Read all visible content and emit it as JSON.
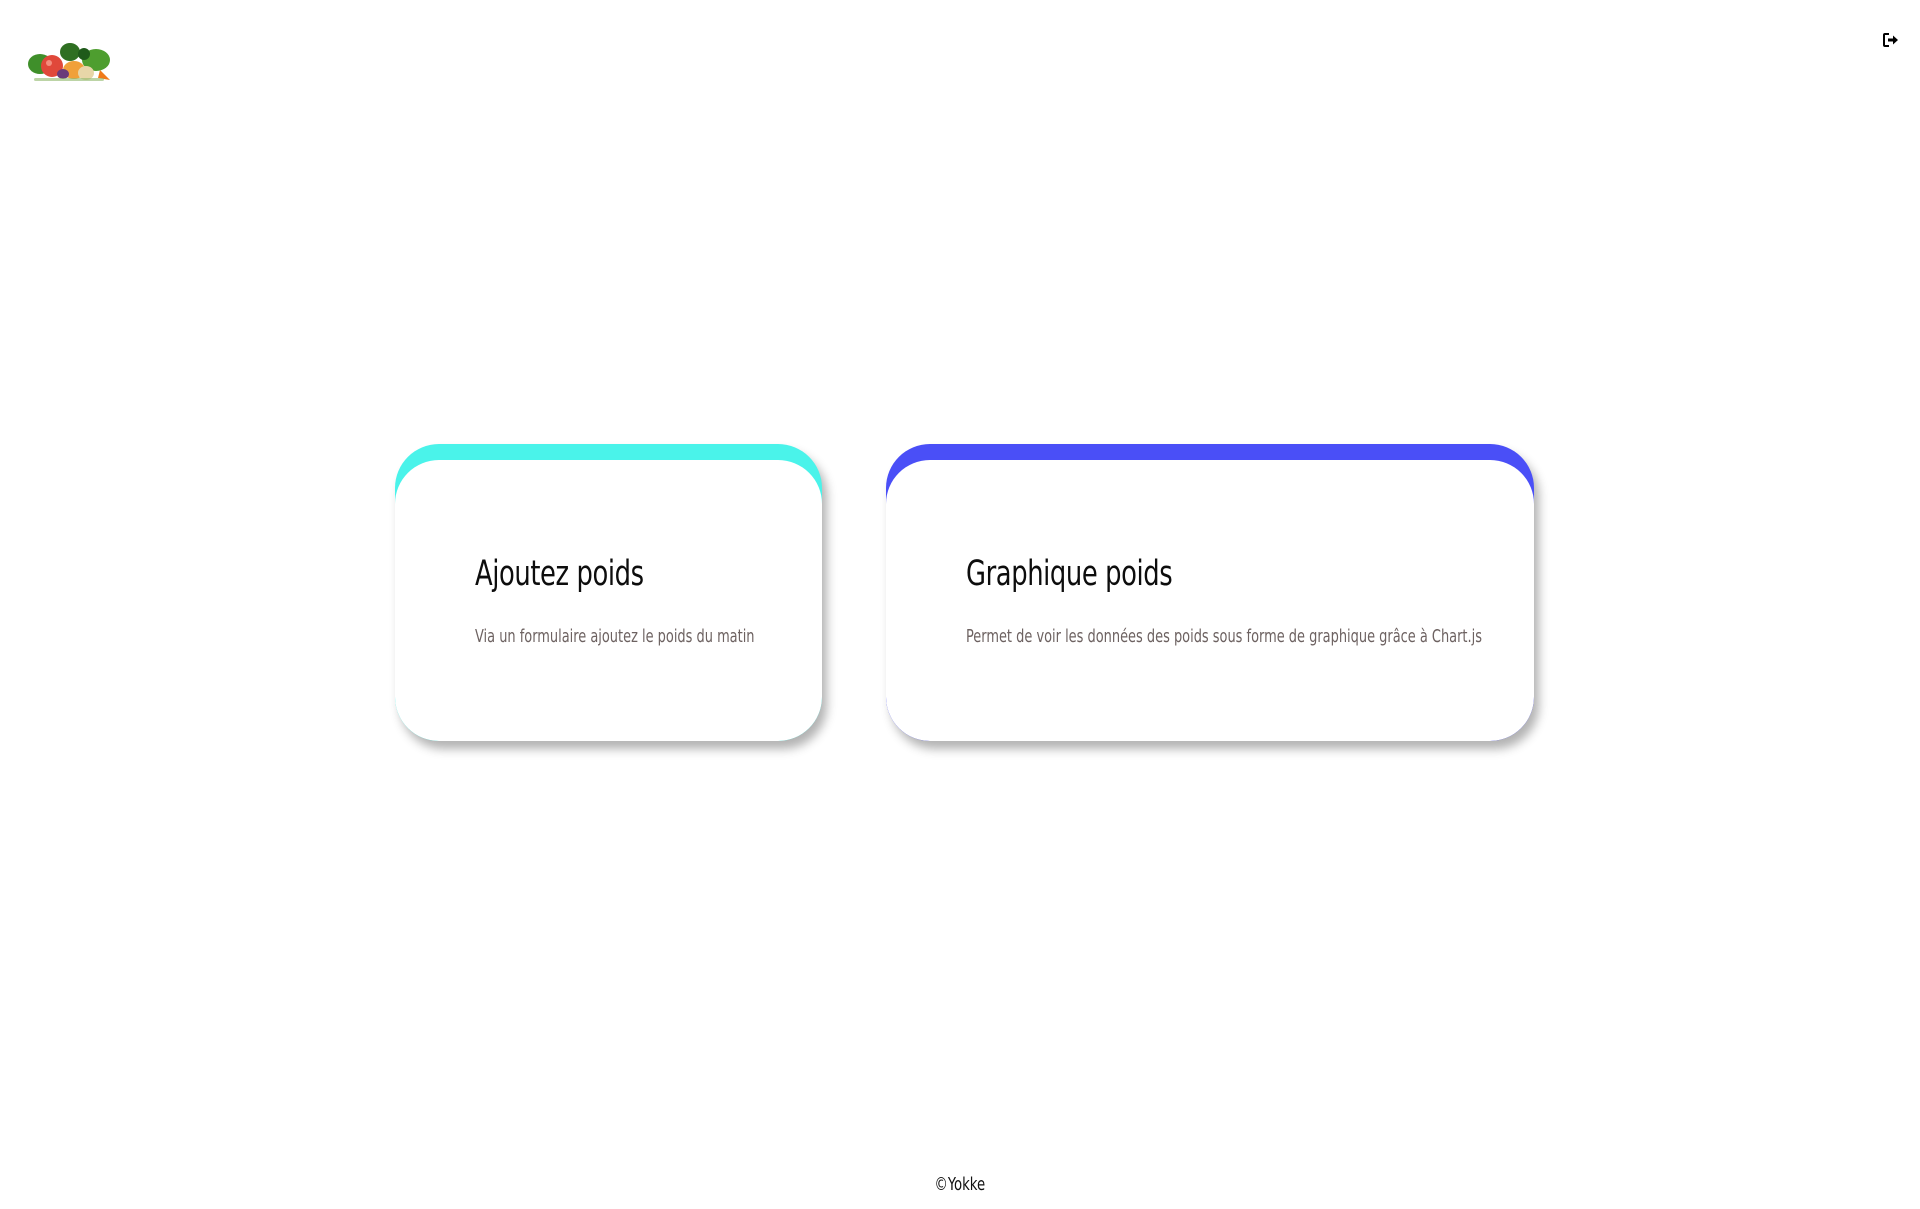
{
  "header": {
    "logo_icon": "vegetables-logo-icon",
    "logout_icon": "sign-out-icon"
  },
  "cards": [
    {
      "title": "Ajoutez poids",
      "description": "Via un formulaire ajoutez le poids du matin",
      "accent_color": "#4af3ea"
    },
    {
      "title": "Graphique poids",
      "description": "Permet de voir les données des poids sous forme de graphique grâce à Chart.js",
      "accent_color": "#4a4ff7"
    }
  ],
  "footer": {
    "copyright": "©Yokke"
  }
}
